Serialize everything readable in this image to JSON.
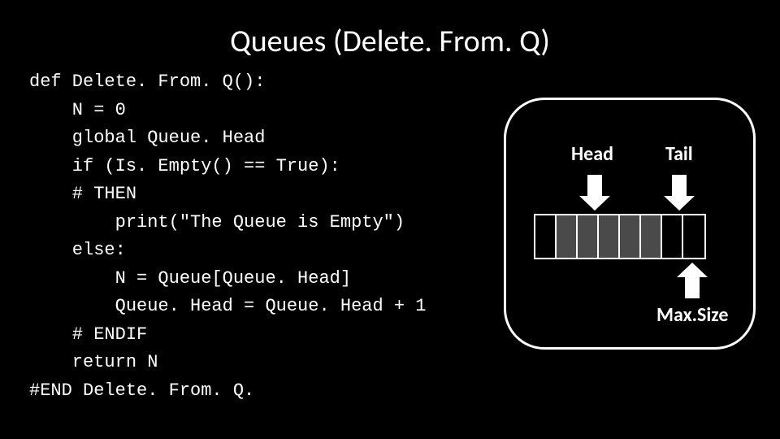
{
  "title": "Queues (Delete. From. Q)",
  "code": {
    "l1": "def Delete. From. Q():",
    "l2": "    N = 0",
    "l3": "    global Queue. Head",
    "l4": "    if (Is. Empty() == True):",
    "l5": "    # THEN",
    "l6": "        print(\"The Queue is Empty\")",
    "l7": "    else:",
    "l8": "        N = Queue[Queue. Head]",
    "l9": "        Queue. Head = Queue. Head + 1",
    "l10": "    # ENDIF",
    "l11": "    return N",
    "l12": "#END Delete. From. Q."
  },
  "diagram": {
    "head_label": "Head",
    "tail_label": "Tail",
    "maxsize_label": "Max.Size",
    "cells": [
      {
        "filled": false
      },
      {
        "filled": true
      },
      {
        "filled": true
      },
      {
        "filled": true
      },
      {
        "filled": true
      },
      {
        "filled": true
      },
      {
        "filled": false
      },
      {
        "filled": false
      }
    ]
  }
}
